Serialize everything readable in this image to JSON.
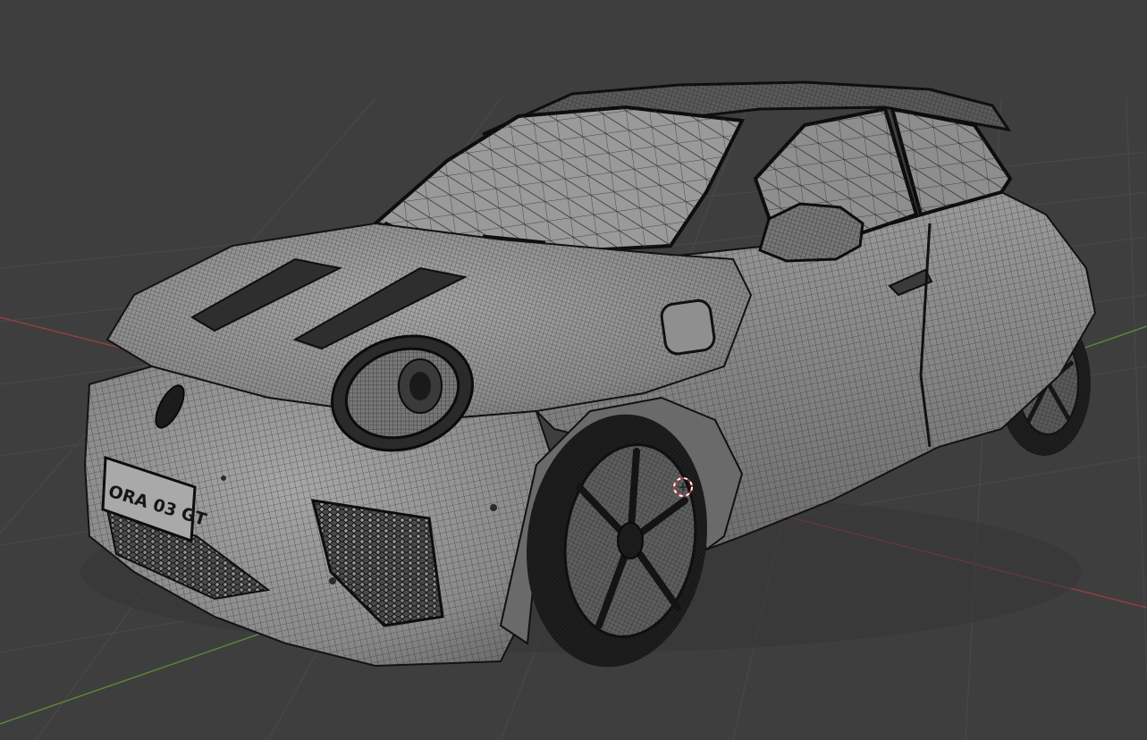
{
  "viewport": {
    "background": "#3e3e3e",
    "grid_color": "#4a4a4a",
    "x_axis_color": "#9c3b43",
    "y_axis_color": "#5c8a3a"
  },
  "model": {
    "body_color": "#8c8c8c",
    "wire_color": "#1a1a1a",
    "glass_color": "#9a9a9a",
    "license_plate_text": "ORA 03 GT"
  },
  "cursor_3d": {
    "ring_colors": [
      "#c83232",
      "#ffffff"
    ]
  }
}
